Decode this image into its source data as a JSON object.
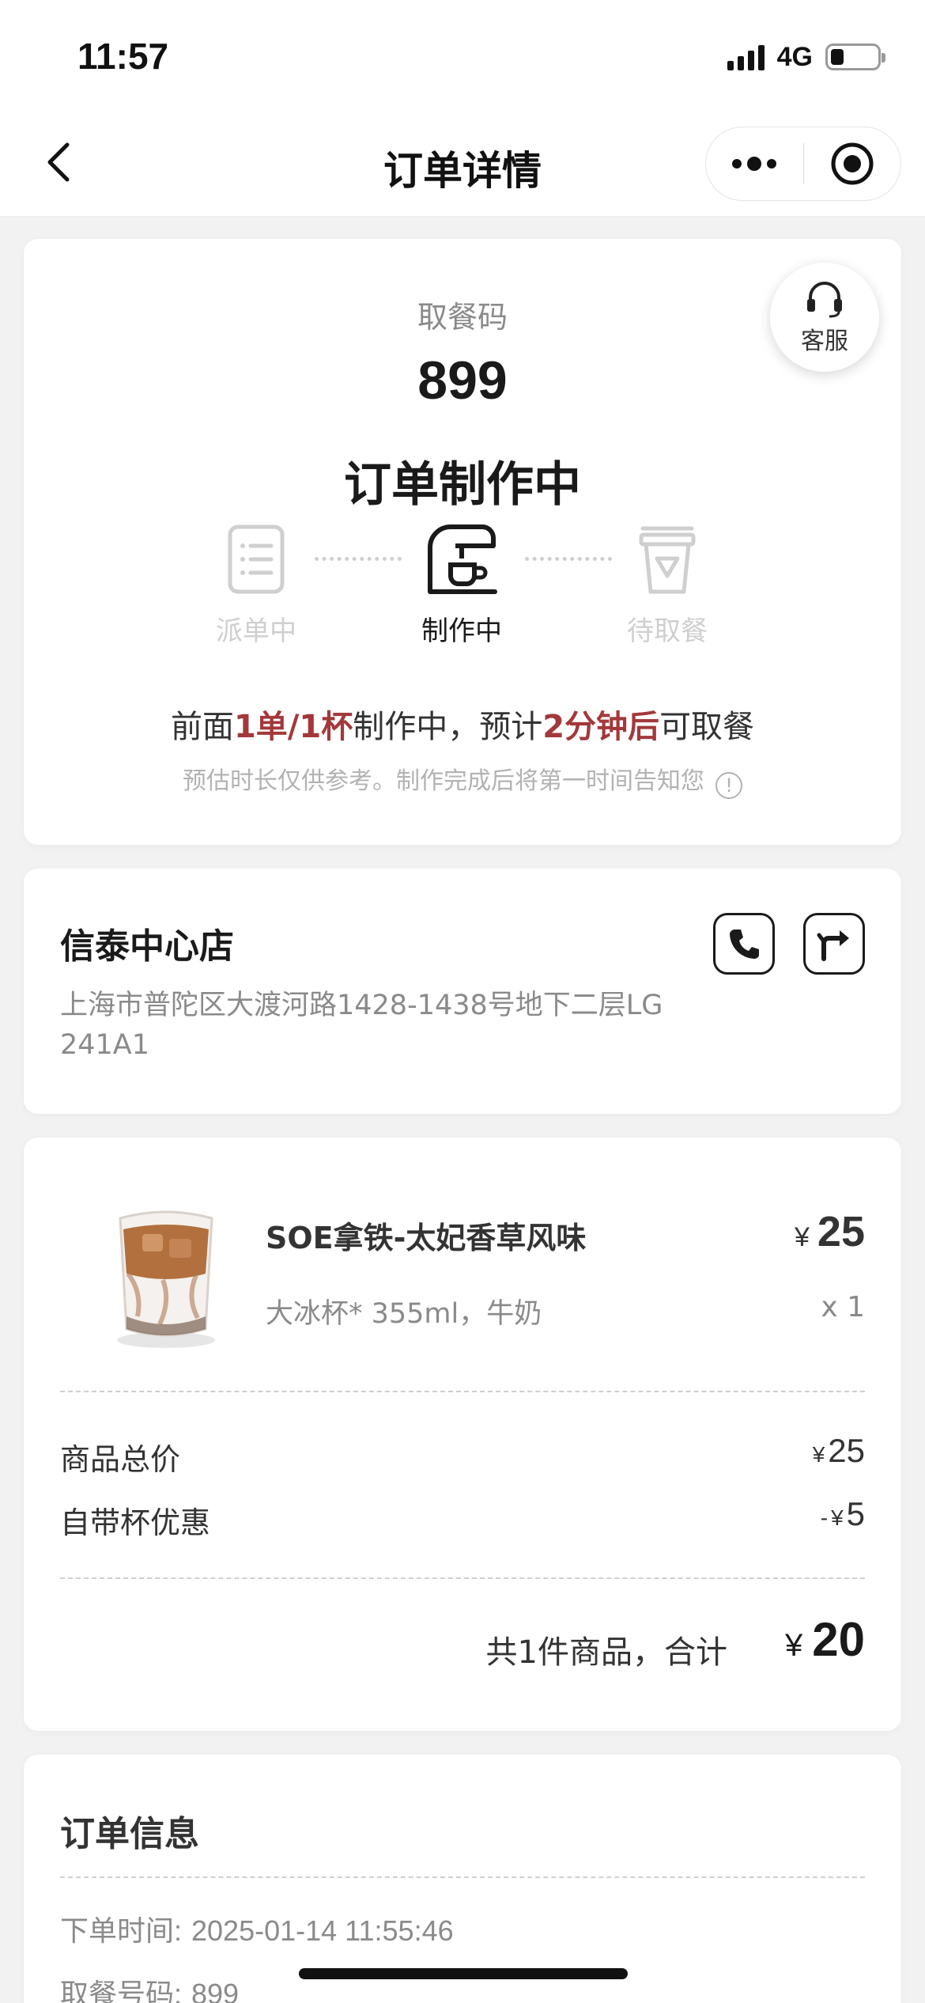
{
  "status_bar": {
    "time": "11:57",
    "network": "4G"
  },
  "nav": {
    "title": "订单详情"
  },
  "status_card": {
    "service_label": "客服",
    "pickup_label": "取餐码",
    "pickup_code": "899",
    "order_state": "订单制作中",
    "steps": [
      {
        "label": "派单中",
        "active": false
      },
      {
        "label": "制作中",
        "active": true
      },
      {
        "label": "待取餐",
        "active": false
      }
    ],
    "estimate": {
      "part1": "前面",
      "highlight1": "1单/1杯",
      "part2": "制作中，预计",
      "highlight2": "2分钟后",
      "part3": "可取餐"
    },
    "note": "预估时长仅供参考。制作完成后将第一时间告知您",
    "info_icon": "!",
    "highlight_color": "#a3383b"
  },
  "store": {
    "name": "信泰中心店",
    "address": "上海市普陀区大渡河路1428-1438号地下二层LG 241A1"
  },
  "product": {
    "name": "SOE拿铁-太妃香草风味",
    "currency": "¥",
    "price": "25",
    "spec": "大冰杯* 355ml，牛奶",
    "qty": "x 1"
  },
  "summary": {
    "subtotal_label": "商品总价",
    "subtotal_value": "25",
    "discount_label": "自带杯优惠",
    "discount_prefix": "-",
    "discount_value": "5",
    "total_label": "共1件商品，合计",
    "total_value": "20"
  },
  "order_info": {
    "title": "订单信息",
    "order_time_label": "下单时间:",
    "order_time": "2025-01-14 11:55:46",
    "pickup_no_label": "取餐号码:",
    "pickup_no": "899"
  }
}
